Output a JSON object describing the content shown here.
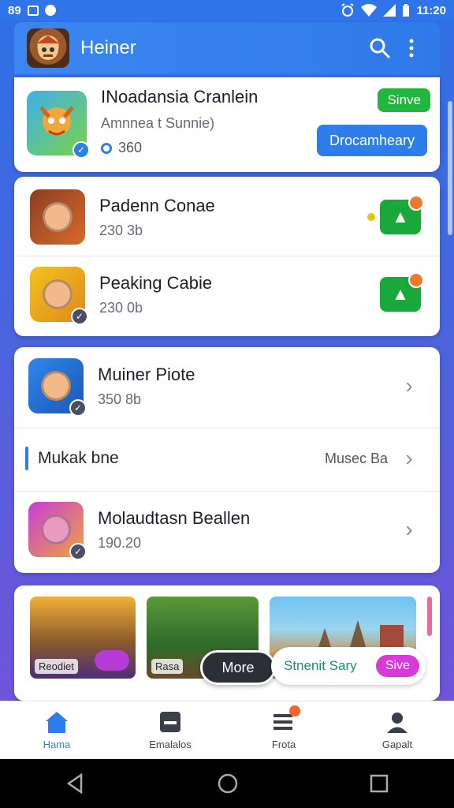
{
  "status_bar": {
    "left_text": "89",
    "time": "11:20"
  },
  "app_bar": {
    "title": "Heiner"
  },
  "featured": {
    "title": "INoadansia Cranlein",
    "subtitle": "Amnnea t Sunnie)",
    "count": "360",
    "tag": "Sinve",
    "button": "Drocamheary"
  },
  "list_a": [
    {
      "title": "Padenn Conae",
      "meta": "230 3b"
    },
    {
      "title": "Peaking Cabie",
      "meta": "230 0b"
    }
  ],
  "list_b": {
    "top": {
      "title": "Muiner Piote",
      "meta": "350 8b"
    },
    "section": {
      "label": "Mukak bne",
      "action": "Musec Ba"
    },
    "bottom": {
      "title": "Molaudtasn Beallen",
      "meta": "190.20"
    }
  },
  "strip": {
    "captions": [
      "Reodiet",
      "Rasa",
      ""
    ],
    "more_label": "More",
    "info_text": "Stnenit Sary",
    "info_button": "Sive"
  },
  "bottom_nav": [
    {
      "label": "Hama",
      "icon": "home-icon",
      "active": true
    },
    {
      "label": "Emalalos",
      "icon": "inbox-icon",
      "active": false
    },
    {
      "label": "Frota",
      "icon": "list-icon",
      "active": false
    },
    {
      "label": "Gapalt",
      "icon": "profile-icon",
      "active": false
    }
  ],
  "colors": {
    "accent": "#2d7eea",
    "green": "#1fb83c",
    "magenta": "#d63ad8"
  }
}
